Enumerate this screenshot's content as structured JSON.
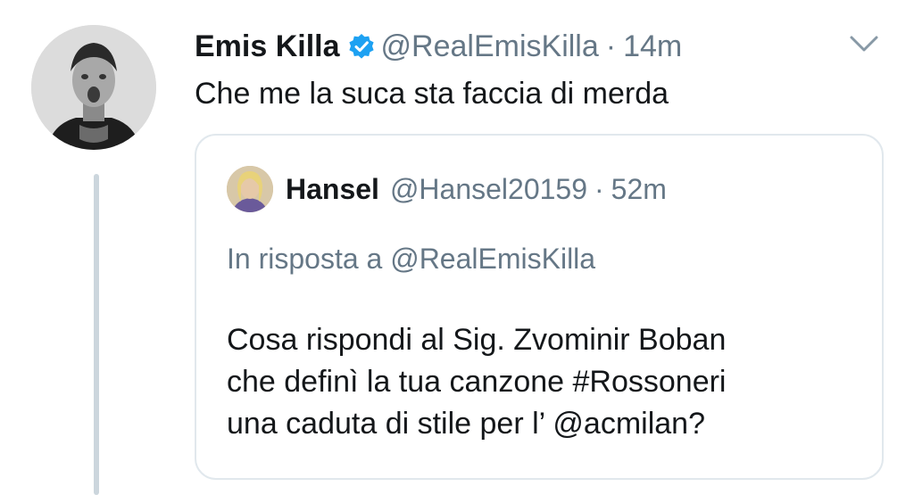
{
  "tweet": {
    "author_name": "Emis Killa",
    "handle": "@RealEmisKilla",
    "separator": "·",
    "time": "14m",
    "text": "Che me la suca sta faccia di merda",
    "avatar_icon": "profile-photo-icon",
    "verified_icon": "verified-badge-icon",
    "menu_icon": "chevron-down-icon"
  },
  "quoted_tweet": {
    "author_name": "Hansel",
    "handle": "@Hansel20159",
    "separator": "·",
    "time": "52m",
    "reply_context": "In risposta a @RealEmisKilla",
    "text_lines": [
      "Cosa rispondi al Sig. Zvominir Boban",
      "che definì la tua canzone #Rossoneri",
      "una caduta di stile per l’ @acmilan?"
    ]
  },
  "colors": {
    "text": "#14171a",
    "secondary": "#657786",
    "border": "#e1e8ed",
    "thread_line": "#ccd6dd",
    "verified": "#1da1f2"
  }
}
